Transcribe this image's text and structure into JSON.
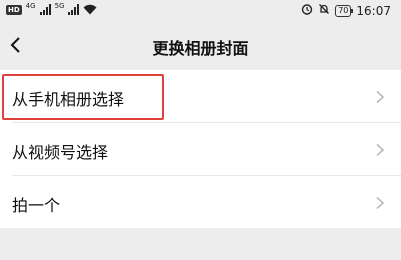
{
  "status_bar": {
    "hd_badge": "HD",
    "net1": "4G",
    "net2": "5G",
    "battery": "70",
    "time": "16:07"
  },
  "nav": {
    "title": "更换相册封面"
  },
  "list": {
    "items": [
      {
        "label": "从手机相册选择"
      },
      {
        "label": "从视频号选择"
      },
      {
        "label": "拍一个"
      }
    ]
  },
  "colors": {
    "background": "#ededed",
    "highlight": "#e0413a",
    "chevron": "#b2b2b2"
  }
}
